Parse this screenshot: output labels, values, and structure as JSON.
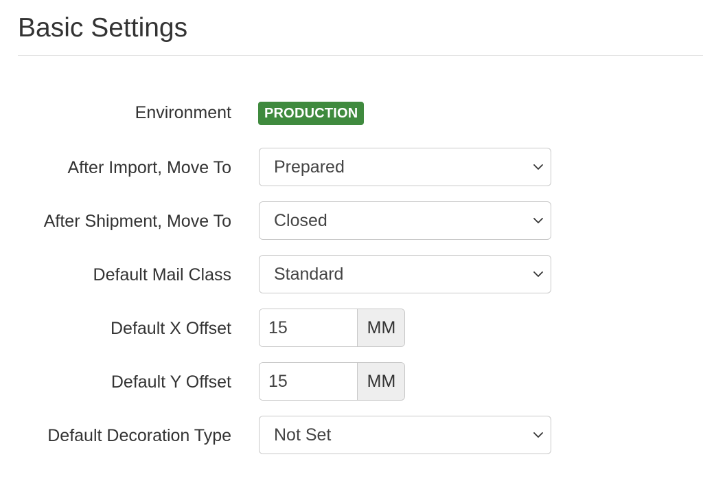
{
  "page": {
    "title": "Basic Settings"
  },
  "colors": {
    "production_badge": "#3f8a3e"
  },
  "settings": {
    "environment": {
      "label": "Environment",
      "value": "PRODUCTION"
    },
    "after_import": {
      "label": "After Import, Move To",
      "value": "Prepared",
      "icon": "chevron-down-icon"
    },
    "after_shipment": {
      "label": "After Shipment, Move To",
      "value": "Closed",
      "icon": "chevron-down-icon"
    },
    "mail_class": {
      "label": "Default Mail Class",
      "value": "Standard",
      "icon": "chevron-down-icon"
    },
    "x_offset": {
      "label": "Default X Offset",
      "value": "15",
      "unit": "MM"
    },
    "y_offset": {
      "label": "Default Y Offset",
      "value": "15",
      "unit": "MM"
    },
    "decoration_type": {
      "label": "Default Decoration Type",
      "value": "Not Set",
      "icon": "chevron-down-icon"
    }
  }
}
